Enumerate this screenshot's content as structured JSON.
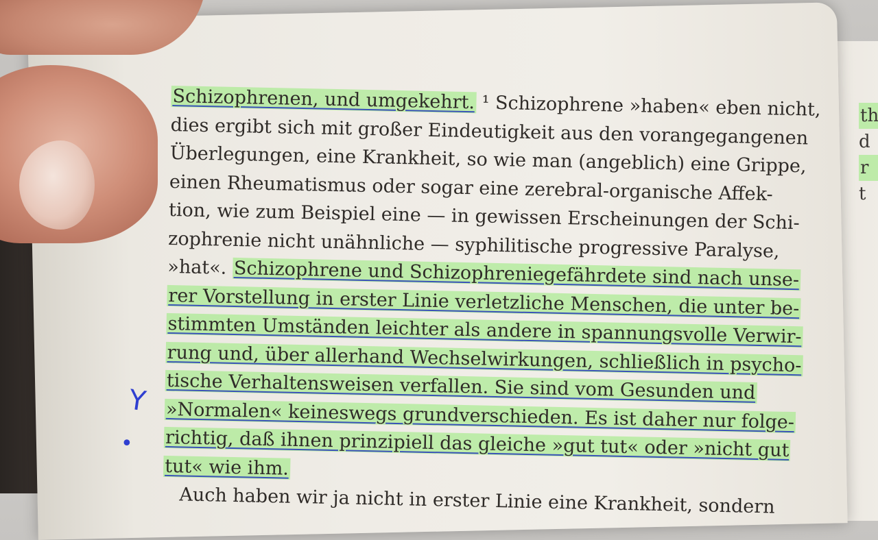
{
  "book_text": {
    "lines": [
      {
        "pre": "",
        "hl": "Schizophrenen, und umgekehrt.",
        "post": "¹ Schizophrene »haben« eben nicht,"
      },
      {
        "pre": "dies ergibt sich mit großer Eindeutigkeit aus den vorangegangenen",
        "hl": "",
        "post": ""
      },
      {
        "pre": "Überlegungen, eine Krankheit, so wie man (angeblich) eine Grippe,",
        "hl": "",
        "post": ""
      },
      {
        "pre": "einen Rheumatismus oder sogar eine zerebral-organische Affek-",
        "hl": "",
        "post": ""
      },
      {
        "pre": "tion, wie zum Beispiel eine — in gewissen Erscheinungen der Schi-",
        "hl": "",
        "post": ""
      },
      {
        "pre": "zophrenie nicht unähnliche — syphilitische progressive Paralyse,",
        "hl": "",
        "post": ""
      },
      {
        "pre": "»hat«. ",
        "hl": "Schizophrene und Schizophreniegefährdete sind nach unse-",
        "post": ""
      },
      {
        "pre": "",
        "hl": "rer Vorstellung in erster Linie verletzliche Menschen, die unter be-",
        "post": ""
      },
      {
        "pre": "",
        "hl": "stimmten Umständen leichter als andere in spannungsvolle Verwir-",
        "post": ""
      },
      {
        "pre": "",
        "hl": "rung und, über allerhand Wechselwirkungen, schließlich in psycho-",
        "post": ""
      },
      {
        "pre": "",
        "hl": "tische Verhaltensweisen verfallen. Sie sind vom Gesunden und",
        "post": ""
      },
      {
        "pre": "",
        "hl": "»Normalen« keineswegs grundverschieden. Es ist daher nur folge-",
        "post": ""
      },
      {
        "pre": "",
        "hl": "richtig, daß ihnen prinzipiell das gleiche »gut tut« oder »nicht gut",
        "post": ""
      },
      {
        "pre": "",
        "hl": "tut« wie ihm.",
        "post": ""
      },
      {
        "pre": "Auch haben wir ja nicht in erster Linie eine Krankheit, sondern",
        "hl": "",
        "post": ""
      }
    ]
  },
  "right_page_fragments": [
    "th",
    "d",
    "r",
    "t"
  ],
  "margin_marks": {
    "mark1": "Y",
    "mark2": "•"
  },
  "colors": {
    "highlighter": "#96eb78",
    "pen": "#3a52b8",
    "paper": "#efece6",
    "ink": "#2f2b28"
  }
}
